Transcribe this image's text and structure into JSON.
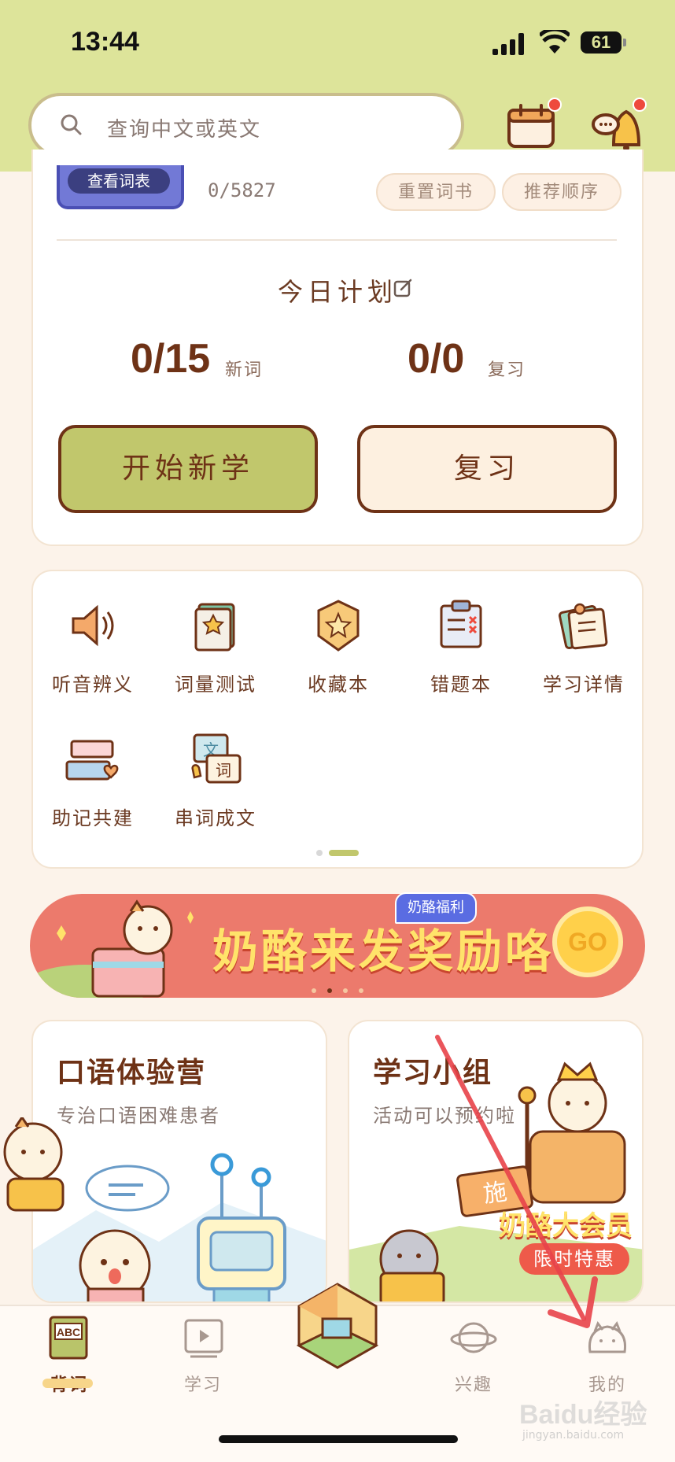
{
  "status_bar": {
    "time": "13:44",
    "battery": "61"
  },
  "search": {
    "placeholder": "查询中文或英文"
  },
  "book": {
    "view_list_label": "查看词表",
    "progress": "0/5827",
    "reset_label": "重置词书",
    "order_label": "推荐顺序"
  },
  "plan": {
    "title": "今日计划",
    "new_count": "0/15",
    "new_label": "新词",
    "review_count": "0/0",
    "review_label": "复习",
    "start_button": "开始新学",
    "review_button": "复习"
  },
  "tools": [
    {
      "label": "听音辨义",
      "icon": "speaker-icon"
    },
    {
      "label": "词量测试",
      "icon": "book-star-icon"
    },
    {
      "label": "收藏本",
      "icon": "star-badge-icon"
    },
    {
      "label": "错题本",
      "icon": "clipboard-x-icon"
    },
    {
      "label": "学习详情",
      "icon": "notepad-icon"
    },
    {
      "label": "助记共建",
      "icon": "cards-heart-icon"
    },
    {
      "label": "串词成文",
      "icon": "wen-ci-icon"
    }
  ],
  "banner": {
    "tag": "奶酪福利",
    "title": "奶酪来发奖励咯",
    "go": "GO"
  },
  "promos": [
    {
      "title": "口语体验营",
      "subtitle": "专治口语困难患者"
    },
    {
      "title": "学习小组",
      "subtitle": "活动可以预约啦",
      "overlay_title": "奶酪大会员",
      "overlay_tag": "限时特惠",
      "sign": "施"
    }
  ],
  "nav": [
    {
      "label": "背词",
      "icon": "abc-book-icon",
      "icon_text": "ABC"
    },
    {
      "label": "学习",
      "icon": "video-book-icon"
    },
    {
      "label": "",
      "icon": "room-house-icon"
    },
    {
      "label": "兴趣",
      "icon": "planet-icon"
    },
    {
      "label": "我的",
      "icon": "hamster-face-icon"
    }
  ],
  "watermark": {
    "text": "Baidu经验",
    "url": "jingyan.baidu.com"
  },
  "colors": {
    "header": "#dde49a",
    "accent": "#c1c76c",
    "brown": "#6e3216",
    "banner": "#ec7a6c",
    "annotation_arrow": "#e8434a"
  }
}
